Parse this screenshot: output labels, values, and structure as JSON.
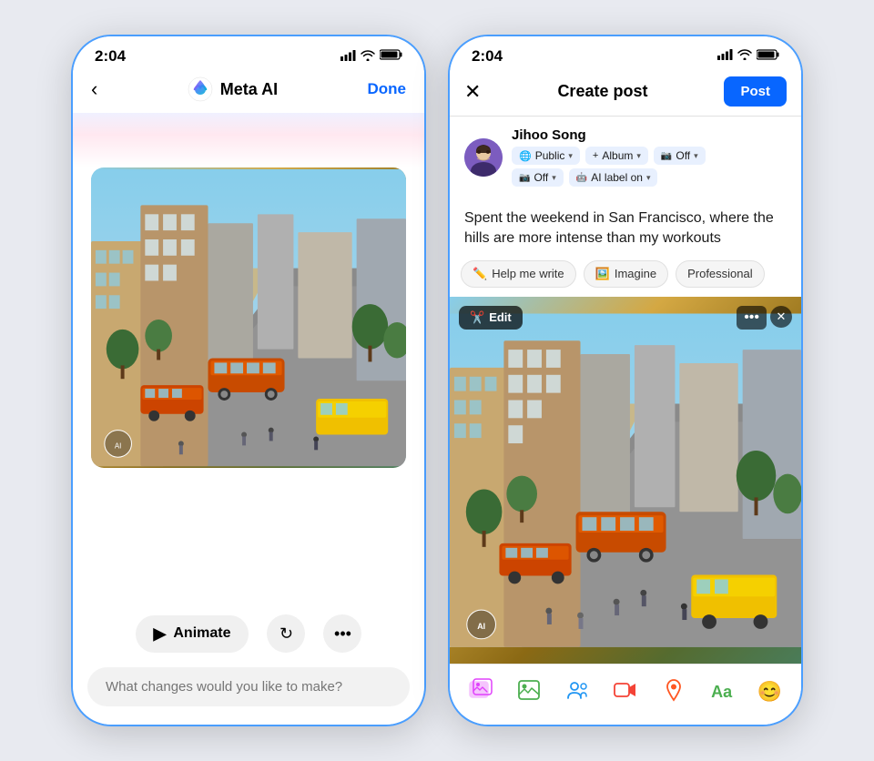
{
  "phone1": {
    "statusBar": {
      "time": "2:04",
      "signal": "▲▲▲",
      "wifi": "WiFi",
      "battery": "🔋"
    },
    "header": {
      "backLabel": "‹",
      "logoAlt": "Meta AI Logo",
      "title": "Meta AI",
      "doneLabel": "Done"
    },
    "image": {
      "alt": "San Francisco street scene with trams and city buildings"
    },
    "actions": {
      "animateLabel": "Animate",
      "refreshLabel": "↻",
      "moreLabel": "•••"
    },
    "input": {
      "placeholder": "What changes would you like to make?"
    }
  },
  "phone2": {
    "statusBar": {
      "time": "2:04",
      "signal": "▲▲▲",
      "wifi": "WiFi",
      "battery": "🔋"
    },
    "header": {
      "closeLabel": "✕",
      "title": "Create post",
      "postLabel": "Post"
    },
    "user": {
      "name": "Jihoo Song",
      "avatar": "person"
    },
    "badges": [
      {
        "icon": "🌐",
        "label": "Public",
        "chevron": "▾"
      },
      {
        "icon": "+",
        "label": "Album",
        "chevron": "▾"
      },
      {
        "icon": "📷",
        "label": "Off",
        "chevron": "▾"
      },
      {
        "icon": "📷",
        "label": "Off",
        "chevron": "▾"
      },
      {
        "icon": "🤖",
        "label": "AI label on",
        "chevron": "▾"
      }
    ],
    "postText": "Spent the weekend in San Francisco, where the hills are more intense than my workouts",
    "aiTools": [
      {
        "icon": "✏️",
        "label": "Help me write"
      },
      {
        "icon": "🖼️",
        "label": "Imagine"
      },
      {
        "label": "Professional"
      }
    ],
    "imageOverlay": {
      "editLabel": "Edit",
      "editIcon": "✂️",
      "dotsLabel": "•••",
      "closeLabel": "✕"
    },
    "toolbar": {
      "icons": [
        {
          "name": "photo-gallery-icon",
          "symbol": "🖼️",
          "color": "#e040fb"
        },
        {
          "name": "image-icon",
          "symbol": "🏞️",
          "color": "#4caf50"
        },
        {
          "name": "tag-people-icon",
          "symbol": "👥",
          "color": "#2196F3"
        },
        {
          "name": "video-icon",
          "symbol": "📹",
          "color": "#f44336"
        },
        {
          "name": "location-icon",
          "symbol": "📍",
          "color": "#FF5722"
        },
        {
          "name": "text-icon",
          "symbol": "Aa",
          "color": "#4CAF50"
        },
        {
          "name": "emoji-icon",
          "symbol": "😊",
          "color": "#FFC107"
        }
      ]
    }
  }
}
